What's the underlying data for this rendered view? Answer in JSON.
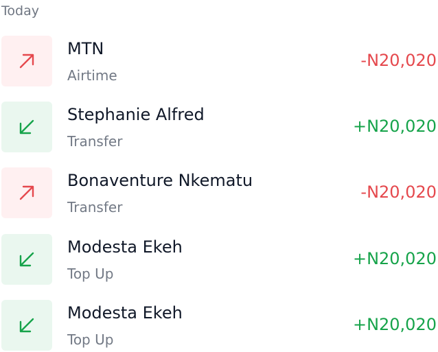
{
  "section_label": "Today",
  "colors": {
    "debit": "#e5484d",
    "credit": "#16a34a",
    "debit_bg": "#fff0f1",
    "credit_bg": "#eaf7ef"
  },
  "transactions": [
    {
      "name": "MTN",
      "type": "Airtime",
      "amount": "-N20,020",
      "direction": "out",
      "icon": "arrow-up-right-icon"
    },
    {
      "name": "Stephanie Alfred",
      "type": "Transfer",
      "amount": "+N20,020",
      "direction": "in",
      "icon": "arrow-down-left-icon"
    },
    {
      "name": "Bonaventure Nkematu",
      "type": "Transfer",
      "amount": "-N20,020",
      "direction": "out",
      "icon": "arrow-up-right-icon"
    },
    {
      "name": "Modesta Ekeh",
      "type": "Top Up",
      "amount": "+N20,020",
      "direction": "in",
      "icon": "arrow-down-left-icon"
    },
    {
      "name": "Modesta Ekeh",
      "type": "Top Up",
      "amount": "+N20,020",
      "direction": "in",
      "icon": "arrow-down-left-icon"
    }
  ]
}
